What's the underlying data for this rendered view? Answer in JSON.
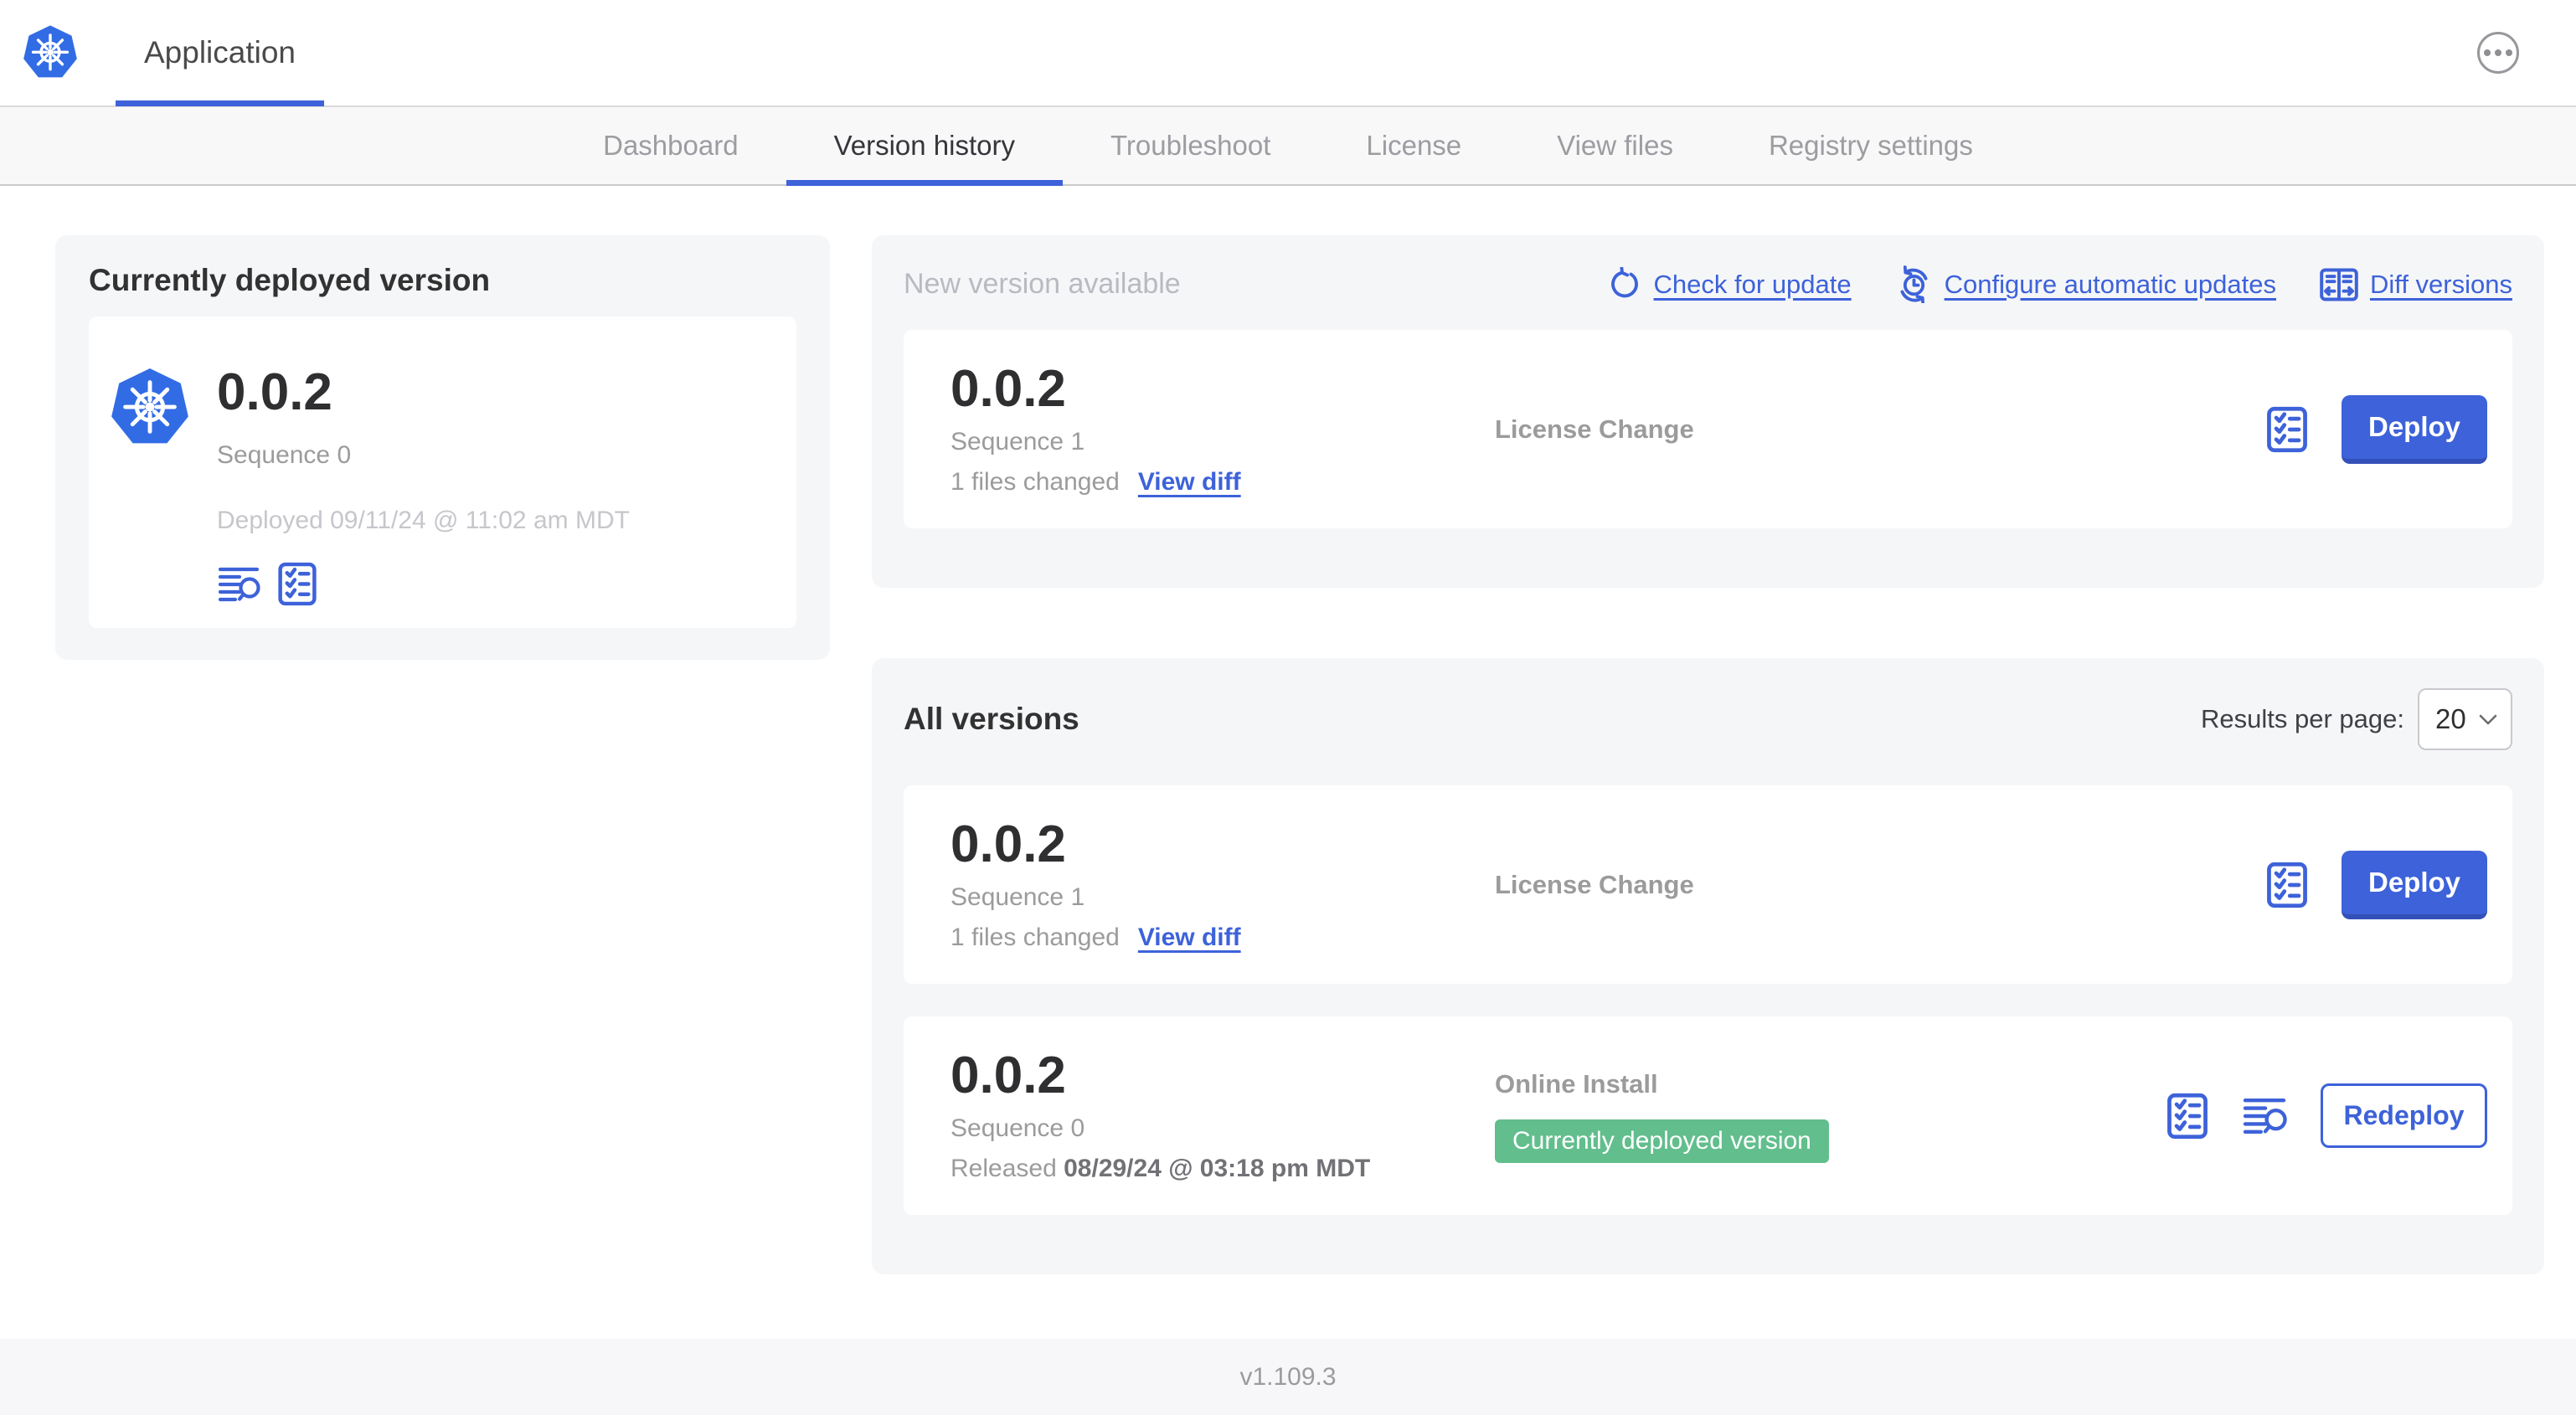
{
  "header": {
    "tab_label": "Application"
  },
  "nav": {
    "tabs": [
      {
        "label": "Dashboard",
        "active": false
      },
      {
        "label": "Version history",
        "active": true
      },
      {
        "label": "Troubleshoot",
        "active": false
      },
      {
        "label": "License",
        "active": false
      },
      {
        "label": "View files",
        "active": false
      },
      {
        "label": "Registry settings",
        "active": false
      }
    ]
  },
  "current_version": {
    "title": "Currently deployed version",
    "version": "0.0.2",
    "sequence": "Sequence 0",
    "deployed": "Deployed 09/11/24 @ 11:02 am MDT"
  },
  "new_version": {
    "title": "New version available",
    "actions": [
      {
        "label": "Check for update",
        "icon": "refresh-icon"
      },
      {
        "label": "Configure automatic updates",
        "icon": "auto-update-clock-icon"
      },
      {
        "label": "Diff versions",
        "icon": "diff-icon"
      }
    ],
    "row": {
      "version": "0.0.2",
      "sequence": "Sequence 1",
      "files_changed": "1 files changed",
      "view_diff_label": "View diff",
      "source": "License Change",
      "action_label": "Deploy"
    }
  },
  "all_versions": {
    "title": "All versions",
    "results_per_page_label": "Results per page:",
    "results_per_page_value": "20",
    "rows": [
      {
        "version": "0.0.2",
        "sequence": "Sequence 1",
        "files_changed": "1 files changed",
        "view_diff_label": "View diff",
        "source": "License Change",
        "action_label": "Deploy"
      },
      {
        "version": "0.0.2",
        "sequence": "Sequence 0",
        "released_label": "Released",
        "released_date": "08/29/24 @ 03:18 pm MDT",
        "source": "Online Install",
        "badge": "Currently deployed version",
        "action_label": "Redeploy"
      }
    ]
  },
  "footer": {
    "version": "v1.109.3"
  },
  "colors": {
    "accent": "#3d62d9",
    "badge_green": "#62be8d",
    "k8s_blue": "#326ce5"
  }
}
